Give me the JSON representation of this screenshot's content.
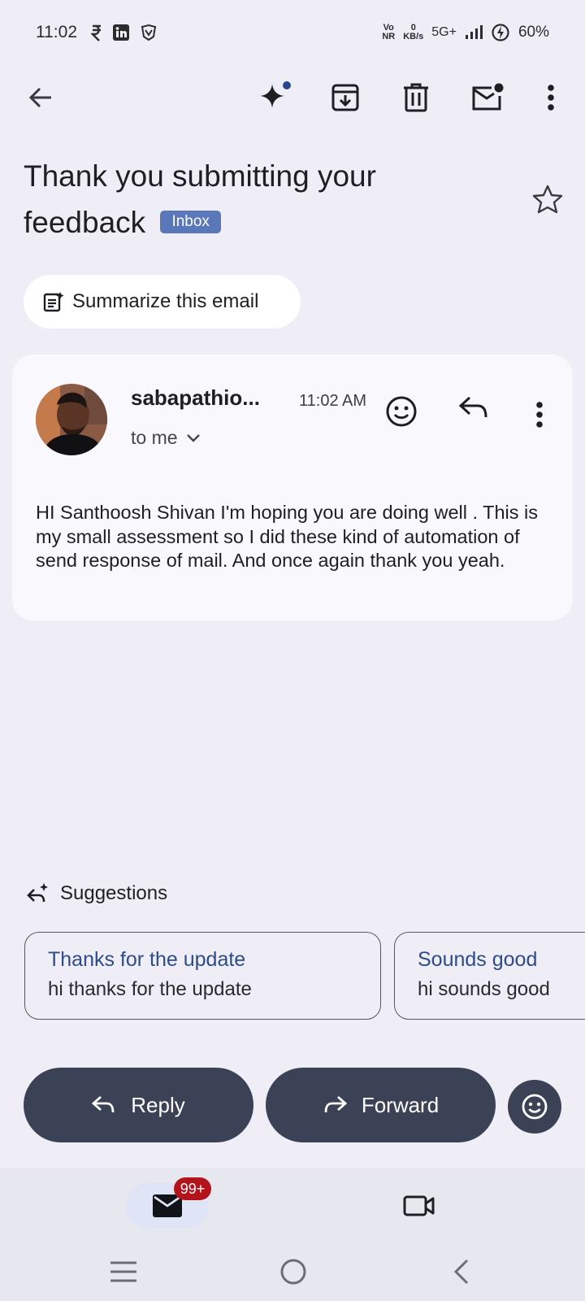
{
  "status_bar": {
    "time": "11:02",
    "network_vo": "Vo",
    "network_nr": "NR",
    "speed_value": "0",
    "speed_unit": "KB/s",
    "network_type": "5G+",
    "battery": "60%"
  },
  "toolbar": {
    "back_icon": "arrow-left-icon",
    "gemini_icon": "sparkle-icon",
    "archive_icon": "archive-icon",
    "delete_icon": "trash-icon",
    "mark_unread_icon": "mail-unread-icon",
    "more_icon": "more-vert-icon"
  },
  "email": {
    "subject": "Thank you submitting your feedback",
    "label": "Inbox",
    "summarize_label": "Summarize this email",
    "sender": "sabapathio...",
    "time": "11:02 AM",
    "recipient": "to me",
    "body": "HI Santhoosh Shivan I'm hoping you are doing well . This is my small assessment so I did these kind of automation of send response of mail. And once again thank you yeah."
  },
  "suggestions": {
    "heading": "Suggestions",
    "items": [
      {
        "title": "Thanks for the update",
        "text": "hi thanks for the update"
      },
      {
        "title": "Sounds good",
        "text": "hi sounds good"
      }
    ]
  },
  "actions": {
    "reply_label": "Reply",
    "forward_label": "Forward"
  },
  "bottom_nav": {
    "mail_badge": "99+"
  },
  "colors": {
    "background": "#efeef6",
    "card": "#f8f8fd",
    "action_button": "#3b4256",
    "label_chip": "#5a77b9",
    "badge": "#b3141c",
    "suggestion_title": "#2c4c8a"
  }
}
